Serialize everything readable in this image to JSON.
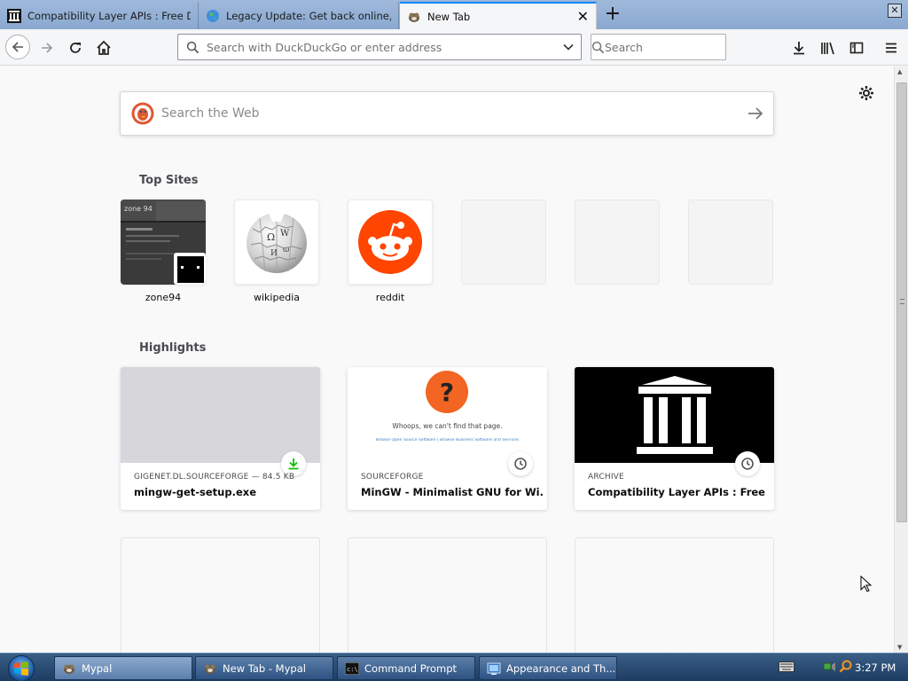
{
  "tabs": [
    {
      "title": "Compatibility Layer APIs : Free Dow",
      "icon": "archive-icon"
    },
    {
      "title": "Legacy Update: Get back online, ac",
      "icon": "globe-icon"
    },
    {
      "title": "New Tab",
      "icon": "mypal-icon"
    }
  ],
  "window": {
    "close_label": "✕"
  },
  "toolbar": {
    "url_placeholder": "Search with DuckDuckGo or enter address",
    "search_placeholder": "Search"
  },
  "newtab": {
    "search_placeholder": "Search the Web",
    "top_sites_title": "Top Sites",
    "top_sites": [
      {
        "label": "zone94"
      },
      {
        "label": "wikipedia"
      },
      {
        "label": "reddit"
      },
      {
        "label": ""
      },
      {
        "label": ""
      },
      {
        "label": ""
      }
    ],
    "highlights_title": "Highlights",
    "highlights": [
      {
        "context": "GIGENET.DL.SOURCEFORGE — 84.5 KB",
        "title": "mingw-get-setup.exe",
        "badge": "download-icon"
      },
      {
        "context": "SOURCEFORGE",
        "title": "MinGW - Minimalist GNU for Wi...",
        "badge": "history-icon",
        "preview_text": "Whoops, we can't find that page.",
        "preview_links": "Browse Open Source Software | Browse Business Software and Services"
      },
      {
        "context": "ARCHIVE",
        "title": "Compatibility Layer APIs : Free D...",
        "badge": "history-icon"
      }
    ]
  },
  "taskbar": {
    "tasks": [
      {
        "label": "Mypal",
        "icon": "mypal-icon"
      },
      {
        "label": "New Tab - Mypal",
        "icon": "mypal-icon"
      },
      {
        "label": "Command Prompt",
        "icon": "cmd-icon"
      },
      {
        "label": "Appearance and Th...",
        "icon": "control-panel-icon"
      }
    ],
    "clock": "3:27 PM"
  },
  "colors": {
    "accent": "#0a84ff",
    "reddit": "#ff4500",
    "ddg": "#de5833",
    "download": "#12bc00"
  }
}
